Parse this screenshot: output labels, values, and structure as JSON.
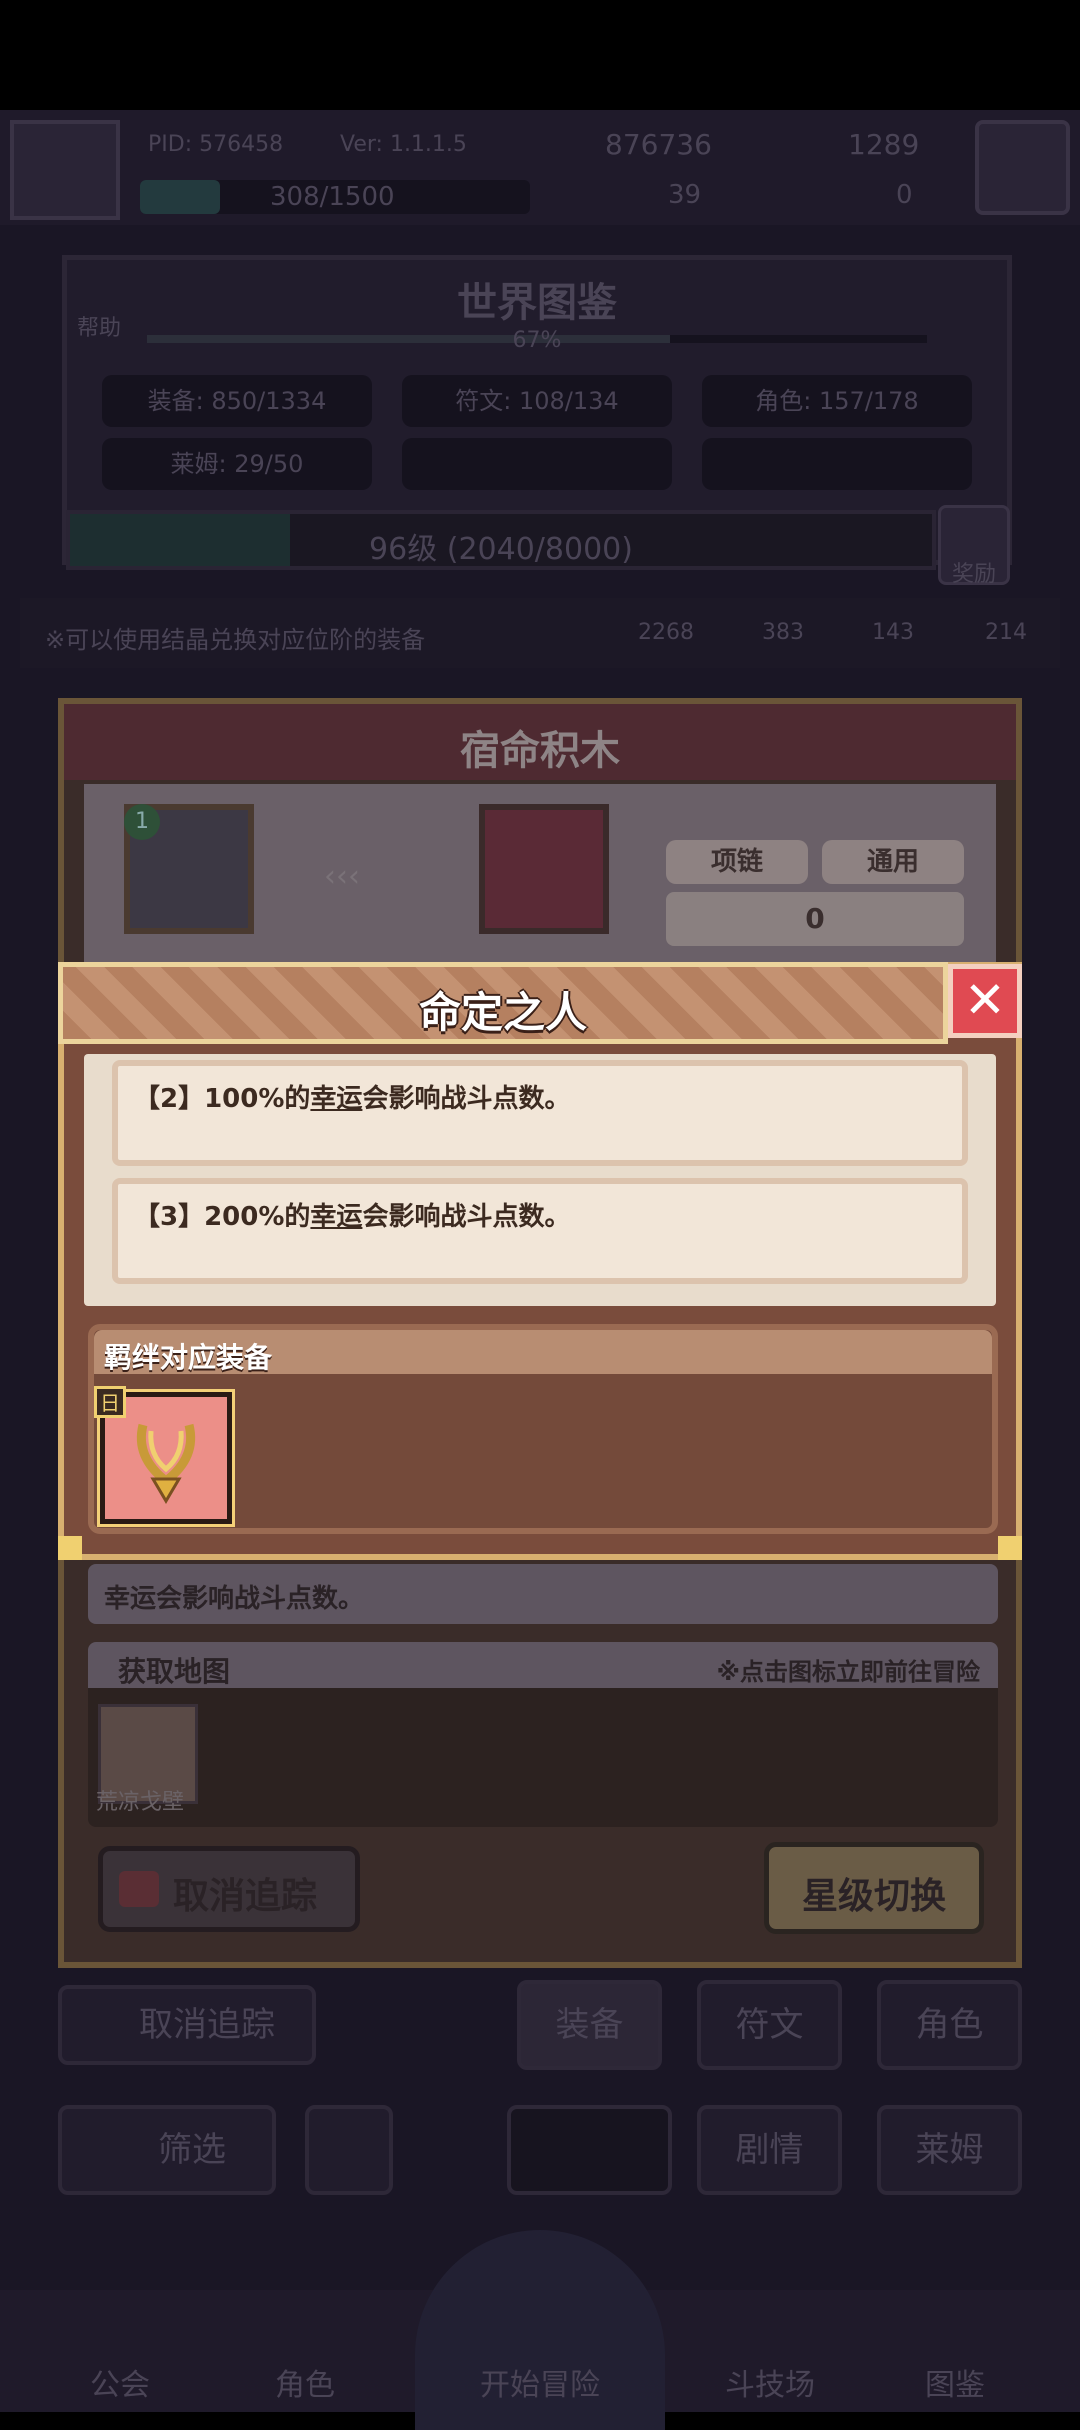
{
  "status_bar": {
    "pid": "PID: 576458",
    "ver": "Ver: 1.1.1.5",
    "gold": "876736",
    "gems": "1289",
    "stamina": "308/1500",
    "keys": "39",
    "tickets": "0"
  },
  "codex": {
    "help_label": "帮助",
    "title": "世界图鉴",
    "progress": "67%",
    "stats": [
      "装备: 850/1334",
      "符文: 108/134",
      "角色: 157/178",
      "莱姆: 29/50"
    ],
    "level": "96级 (2040/8000)",
    "reward_label": "奖励",
    "exchange_hint": "※可以使用结晶兑换对应位阶的装备",
    "crystals": [
      "2268",
      "383",
      "143",
      "214"
    ]
  },
  "bottom_controls": {
    "untrack_label": "取消追踪",
    "tabs": [
      "装备",
      "符文",
      "角色"
    ],
    "filter_label": "筛选",
    "tabs2": [
      "剧情",
      "莱姆"
    ]
  },
  "bottom_nav": [
    "公会",
    "角色",
    "开始冒险",
    "斗技场",
    "图鉴"
  ],
  "item_modal": {
    "title": "宿命积木",
    "char_level": "1",
    "tag_type": "项链",
    "tag_general": "通用",
    "count": "0",
    "desc": "幸运会影响战斗点数。",
    "map_header": "获取地图",
    "map_hint": "※点击图标立即前往冒险",
    "map_name": "荒凉戈壁",
    "untrack_btn": "取消追踪",
    "star_btn": "星级切换"
  },
  "fate_modal": {
    "title": "命定之人",
    "bonds": [
      {
        "prefix": "【2】100%的",
        "keyword": "幸运",
        "suffix": "会影响战斗点数。"
      },
      {
        "prefix": "【3】200%的",
        "keyword": "幸运",
        "suffix": "会影响战斗点数。"
      }
    ],
    "equip_header": "羁绊对应装备",
    "equip_grade": "日"
  },
  "colors": {
    "accent": "#e04a52",
    "panel_brown": "#6f4a3c",
    "cream": "#e8dccc"
  }
}
